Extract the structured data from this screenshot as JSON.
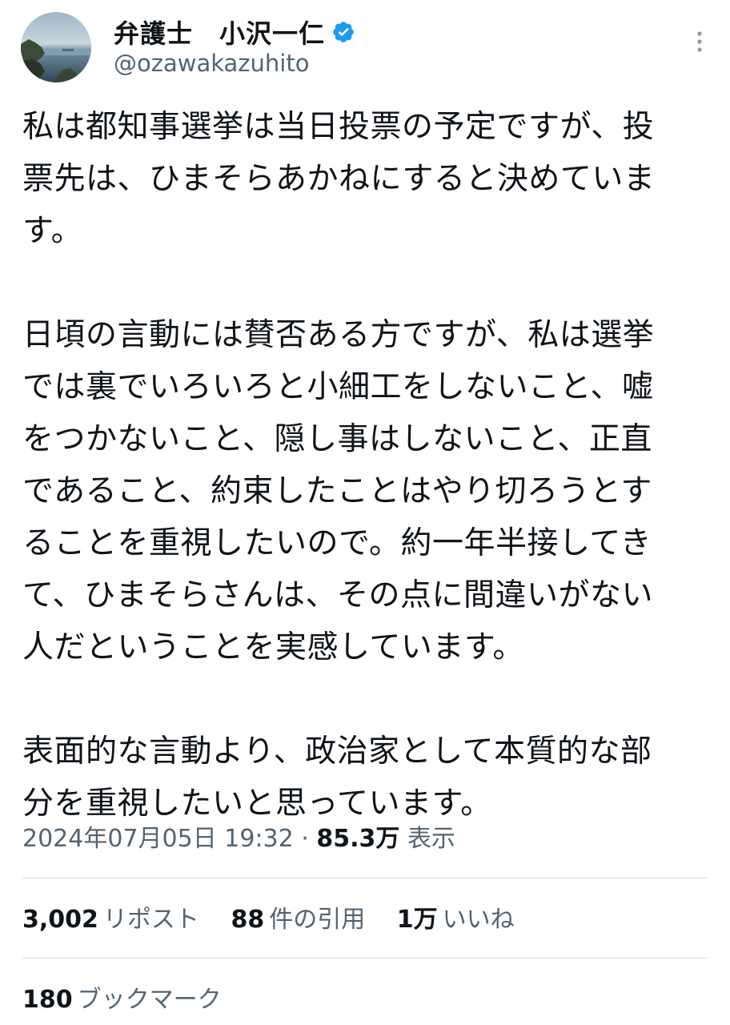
{
  "author": {
    "display_name": "弁護士　小沢一仁",
    "handle": "@ozawakazuhito",
    "verified": true,
    "verified_color": "#1d9bf0"
  },
  "tweet": {
    "lines": [
      "私は都知事選挙は当日投票の予定ですが、投",
      "票先は、ひまそらあかねにすると決めていま",
      "す。",
      "",
      "日頃の言動には賛否ある方ですが、私は選挙",
      "では裏でいろいろと小細工をしないこと、嘘",
      "をつかないこと、隠し事はしないこと、正直",
      "であること、約束したことはやり切ろうとす",
      "ることを重視したいので。約一年半接してき",
      "て、ひまそらさんは、その点に間違いがない",
      "人だということを実感しています。",
      "",
      "表面的な言動より、政治家として本質的な部",
      "分を重視したいと思っています。"
    ]
  },
  "meta": {
    "timestamp": "2024年07月05日 19:32",
    "separator": "·",
    "views_count": "85.3万",
    "views_label": "表示"
  },
  "stats": {
    "reposts_count": "3,002",
    "reposts_label": "リポスト",
    "quotes_count": "88",
    "quotes_label": "件の引用",
    "likes_count": "1万",
    "likes_label": "いいね",
    "bookmarks_count": "180",
    "bookmarks_label": "ブックマーク"
  },
  "colors": {
    "text_primary": "#0f1419",
    "text_secondary": "#536471",
    "divider": "#d9dde1"
  },
  "icons": {
    "verified": "verified-badge-icon",
    "more": "more-vertical-icon"
  }
}
